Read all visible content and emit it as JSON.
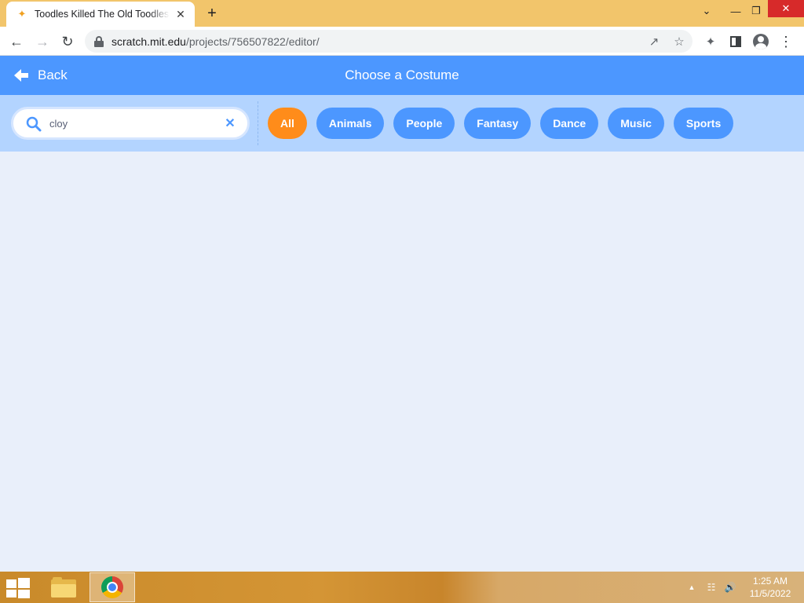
{
  "browser": {
    "tab": {
      "title": "Toodles Killed The Old Toodles o",
      "favicon": "scratch-cat-icon"
    },
    "url": {
      "host": "scratch.mit.edu",
      "path": "/projects/756507822/editor/"
    }
  },
  "header": {
    "back_label": "Back",
    "title": "Choose a Costume"
  },
  "search": {
    "value": "cloy",
    "clear_glyph": "✕"
  },
  "tags": [
    {
      "label": "All",
      "active": true
    },
    {
      "label": "Animals",
      "active": false
    },
    {
      "label": "People",
      "active": false
    },
    {
      "label": "Fantasy",
      "active": false
    },
    {
      "label": "Dance",
      "active": false
    },
    {
      "label": "Music",
      "active": false
    },
    {
      "label": "Sports",
      "active": false
    }
  ],
  "taskbar": {
    "apps": [
      "file-explorer-icon",
      "chrome-icon"
    ],
    "clock": {
      "time": "1:25 AM",
      "date": "11/5/2022"
    }
  },
  "colors": {
    "scratch_blue": "#4c97ff",
    "active_tag": "#ff8c1a",
    "filter_bar": "#b3d4ff",
    "content_bg": "#e9effa",
    "browser_frame": "#f2c56b"
  }
}
